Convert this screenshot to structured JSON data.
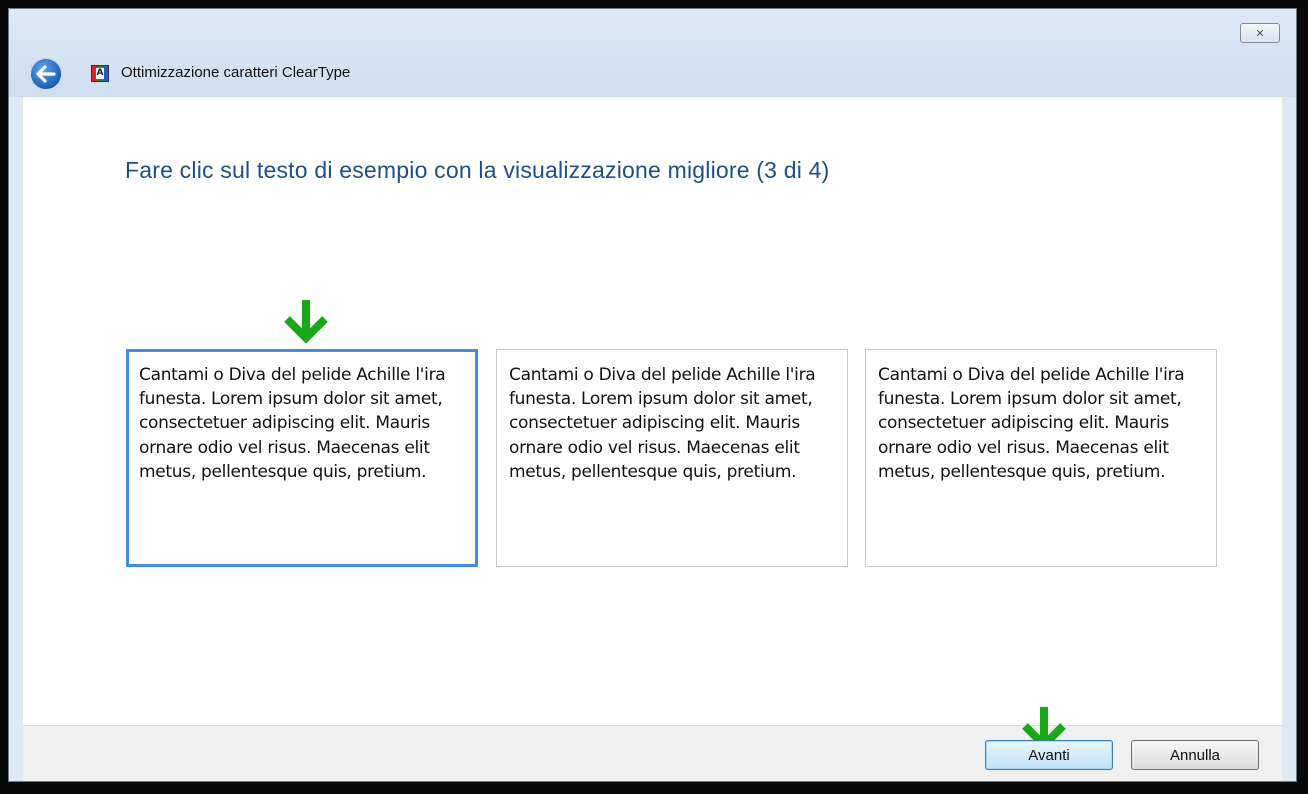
{
  "window": {
    "title": "Ottimizzazione caratteri ClearType",
    "close_symbol": "✕",
    "app_icon_letter": "A"
  },
  "main": {
    "heading": "Fare clic sul testo di esempio con la visualizzazione migliore (3 di 4)",
    "samples": [
      {
        "text": "Cantami o Diva del pelide Achille l'ira funesta. Lorem ipsum dolor sit amet, consectetuer adipiscing elit. Mauris ornare odio vel risus. Maecenas elit metus, pellentesque quis, pretium.",
        "selected": true
      },
      {
        "text": "Cantami o Diva del pelide Achille l'ira funesta. Lorem ipsum dolor sit amet, consectetuer adipiscing elit. Mauris ornare odio vel risus. Maecenas elit metus, pellentesque quis, pretium.",
        "selected": false
      },
      {
        "text": "Cantami o Diva del pelide Achille l'ira funesta. Lorem ipsum dolor sit amet, consectetuer adipiscing elit. Mauris ornare odio vel risus. Maecenas elit metus, pellentesque quis, pretium.",
        "selected": false
      }
    ]
  },
  "footer": {
    "next_label": "Avanti",
    "cancel_label": "Annulla"
  },
  "colors": {
    "heading": "#1e4f86",
    "selection_border": "#3d8ee6",
    "annotation_arrow": "#18a818"
  },
  "icons": {
    "back": "back-arrow-icon",
    "app": "cleartype-icon",
    "close": "close-icon",
    "annotation": "down-arrow-icon"
  }
}
